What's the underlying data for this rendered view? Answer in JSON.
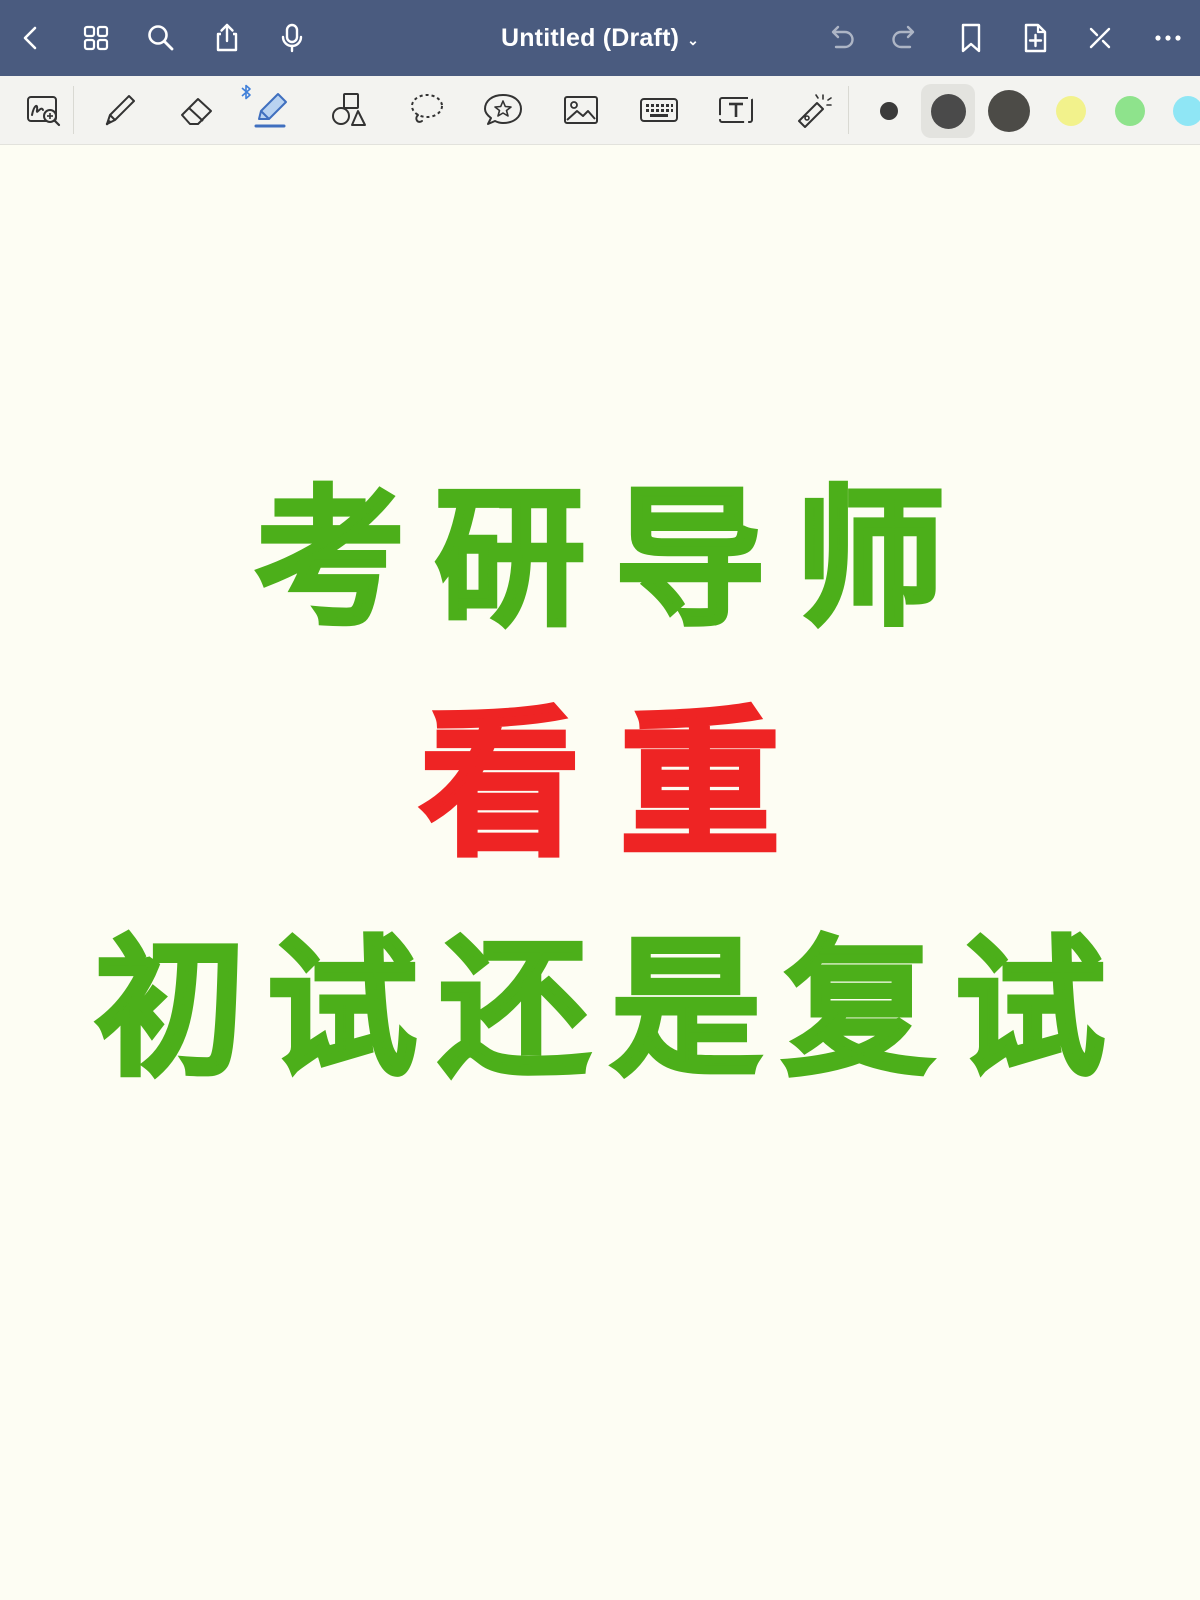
{
  "topbar": {
    "title": "Untitled (Draft)",
    "title_chevron": "⌄",
    "background": "#4a5b7f",
    "left_icons": [
      "back-icon",
      "grid-icon",
      "search-icon",
      "share-icon",
      "microphone-icon"
    ],
    "right_icons": [
      "undo-icon",
      "redo-icon",
      "bookmark-icon",
      "add-page-icon",
      "close-edit-icon",
      "more-icon"
    ]
  },
  "toolbar": {
    "tools": [
      "zoom-window-tool",
      "pen-tool",
      "eraser-tool",
      "highlighter-tool",
      "shapes-tool",
      "lasso-tool",
      "elements-tool",
      "image-tool",
      "keyboard-tool",
      "text-tool",
      "laser-pointer-tool"
    ],
    "active_tool": "highlighter-tool",
    "bluetooth_indicator": "bluetooth-icon",
    "colors": [
      "#3a3a3a",
      "#4a4a4a",
      "#4c4b47",
      "#f2f28c",
      "#8ee38c",
      "#8fe6f5"
    ],
    "selected_color_index": 1
  },
  "canvas": {
    "background": "#fdfdf3",
    "lines": [
      {
        "text": "考研导师",
        "color": "#4caf1a"
      },
      {
        "text": "看重",
        "color": "#ee2424"
      },
      {
        "text": "初试还是复试",
        "color": "#4caf1a"
      }
    ]
  }
}
